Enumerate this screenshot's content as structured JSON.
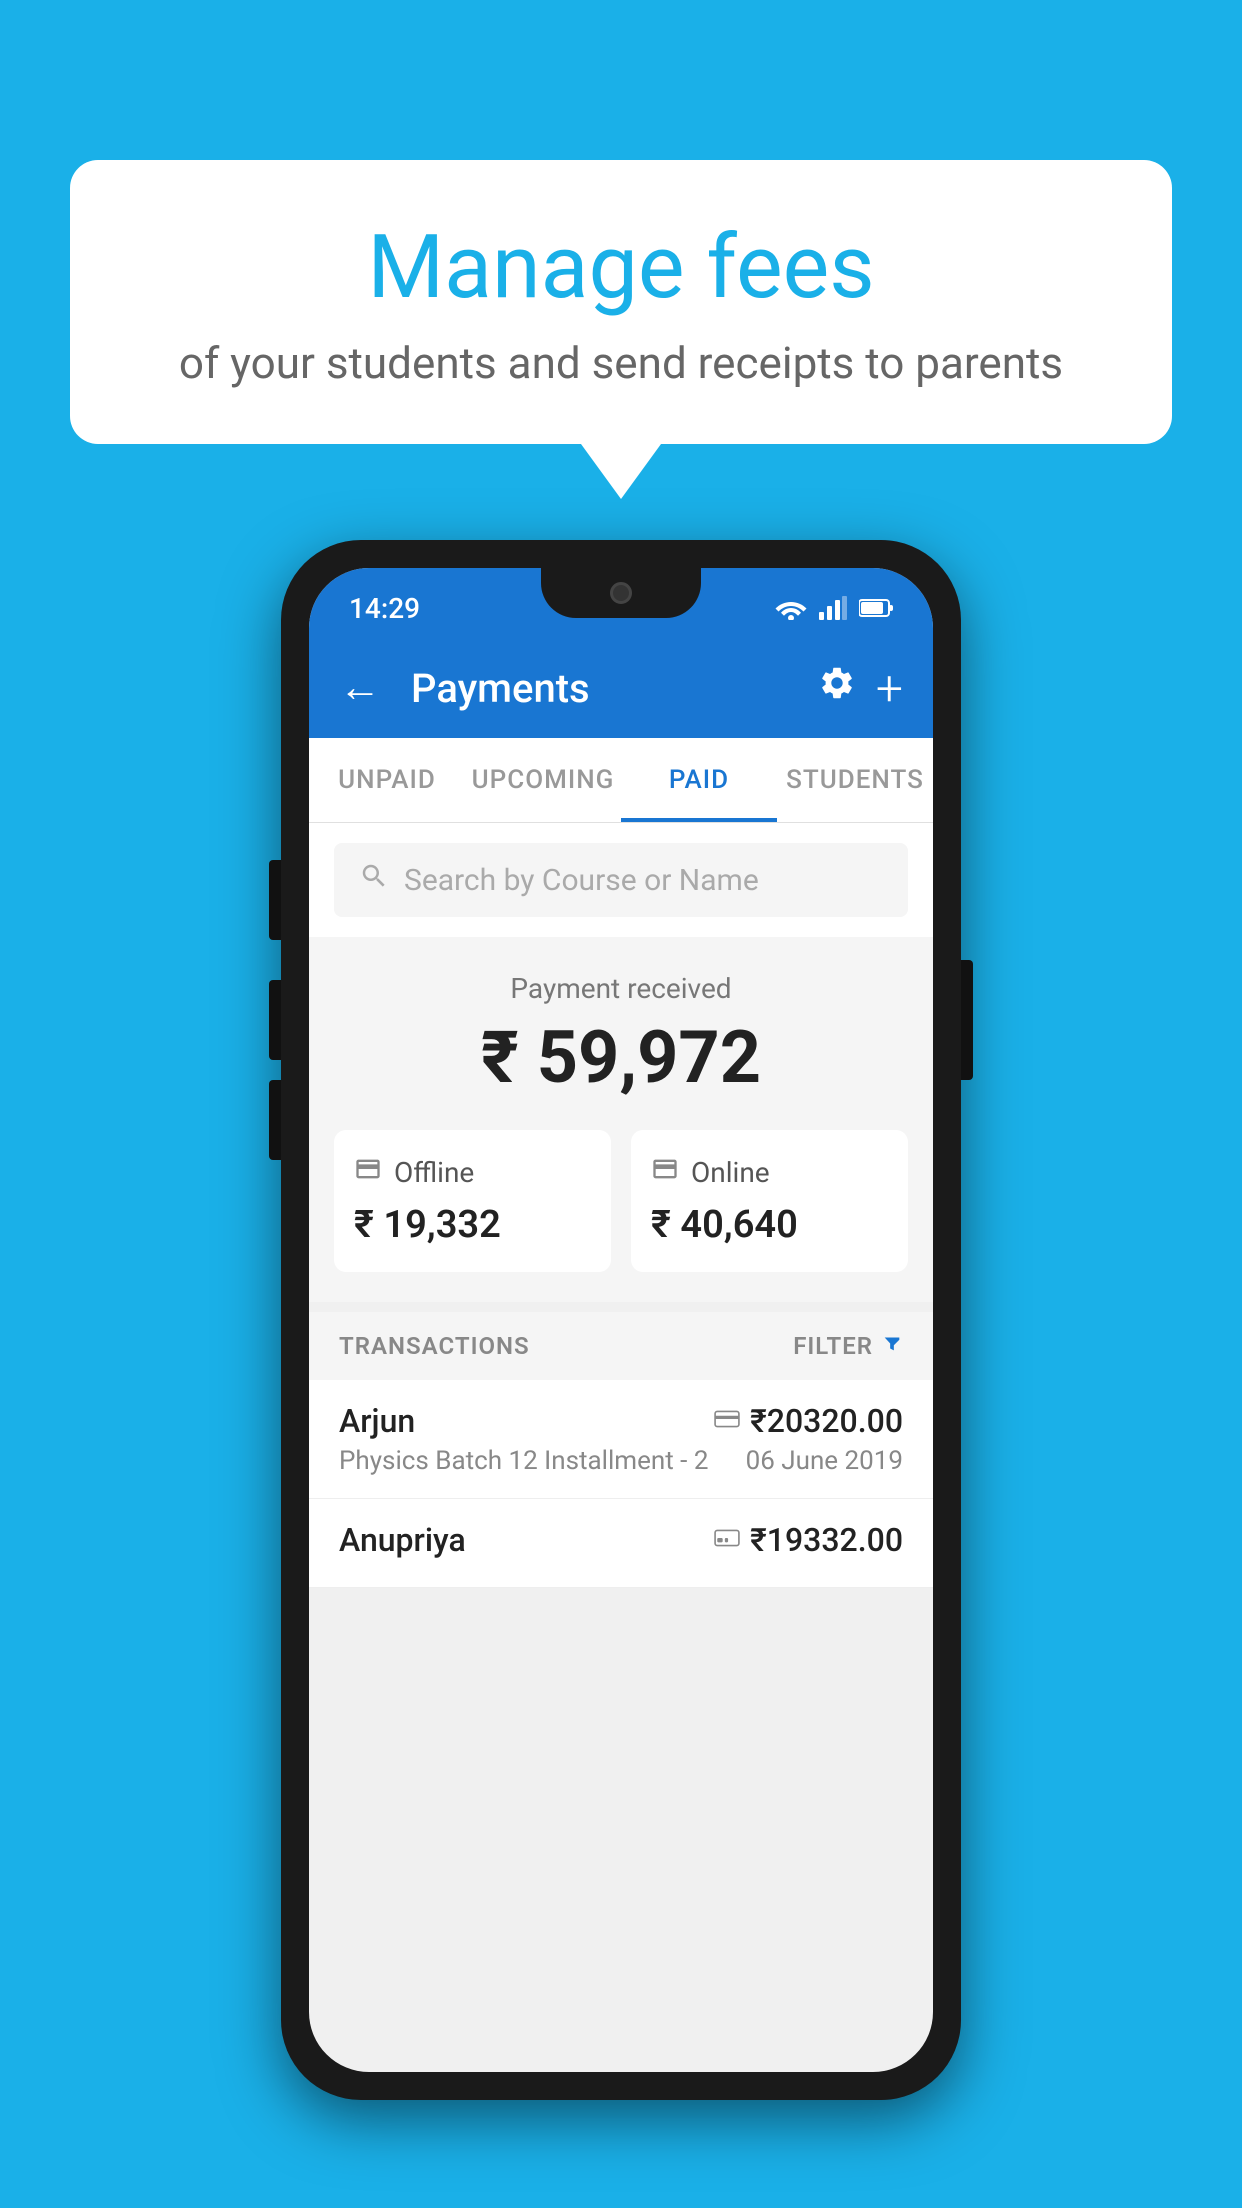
{
  "background_color": "#1ab0e8",
  "speech_bubble": {
    "title": "Manage fees",
    "subtitle": "of your students and send receipts to parents"
  },
  "status_bar": {
    "time": "14:29",
    "wifi": "▼",
    "signal": "▲",
    "battery": "▮"
  },
  "header": {
    "title": "Payments",
    "back_label": "←",
    "settings_label": "⚙",
    "add_label": "+"
  },
  "tabs": [
    {
      "label": "UNPAID",
      "active": false
    },
    {
      "label": "UPCOMING",
      "active": false
    },
    {
      "label": "PAID",
      "active": true
    },
    {
      "label": "STUDENTS",
      "active": false
    }
  ],
  "search": {
    "placeholder": "Search by Course or Name"
  },
  "payment_summary": {
    "label": "Payment received",
    "total": "₹ 59,972",
    "offline": {
      "label": "Offline",
      "amount": "₹ 19,332"
    },
    "online": {
      "label": "Online",
      "amount": "₹ 40,640"
    }
  },
  "transactions": {
    "header_label": "TRANSACTIONS",
    "filter_label": "FILTER",
    "items": [
      {
        "name": "Arjun",
        "course": "Physics Batch 12 Installment - 2",
        "amount": "₹20320.00",
        "date": "06 June 2019",
        "method": "card"
      },
      {
        "name": "Anupriya",
        "course": "",
        "amount": "₹19332.00",
        "date": "",
        "method": "offline"
      }
    ]
  }
}
